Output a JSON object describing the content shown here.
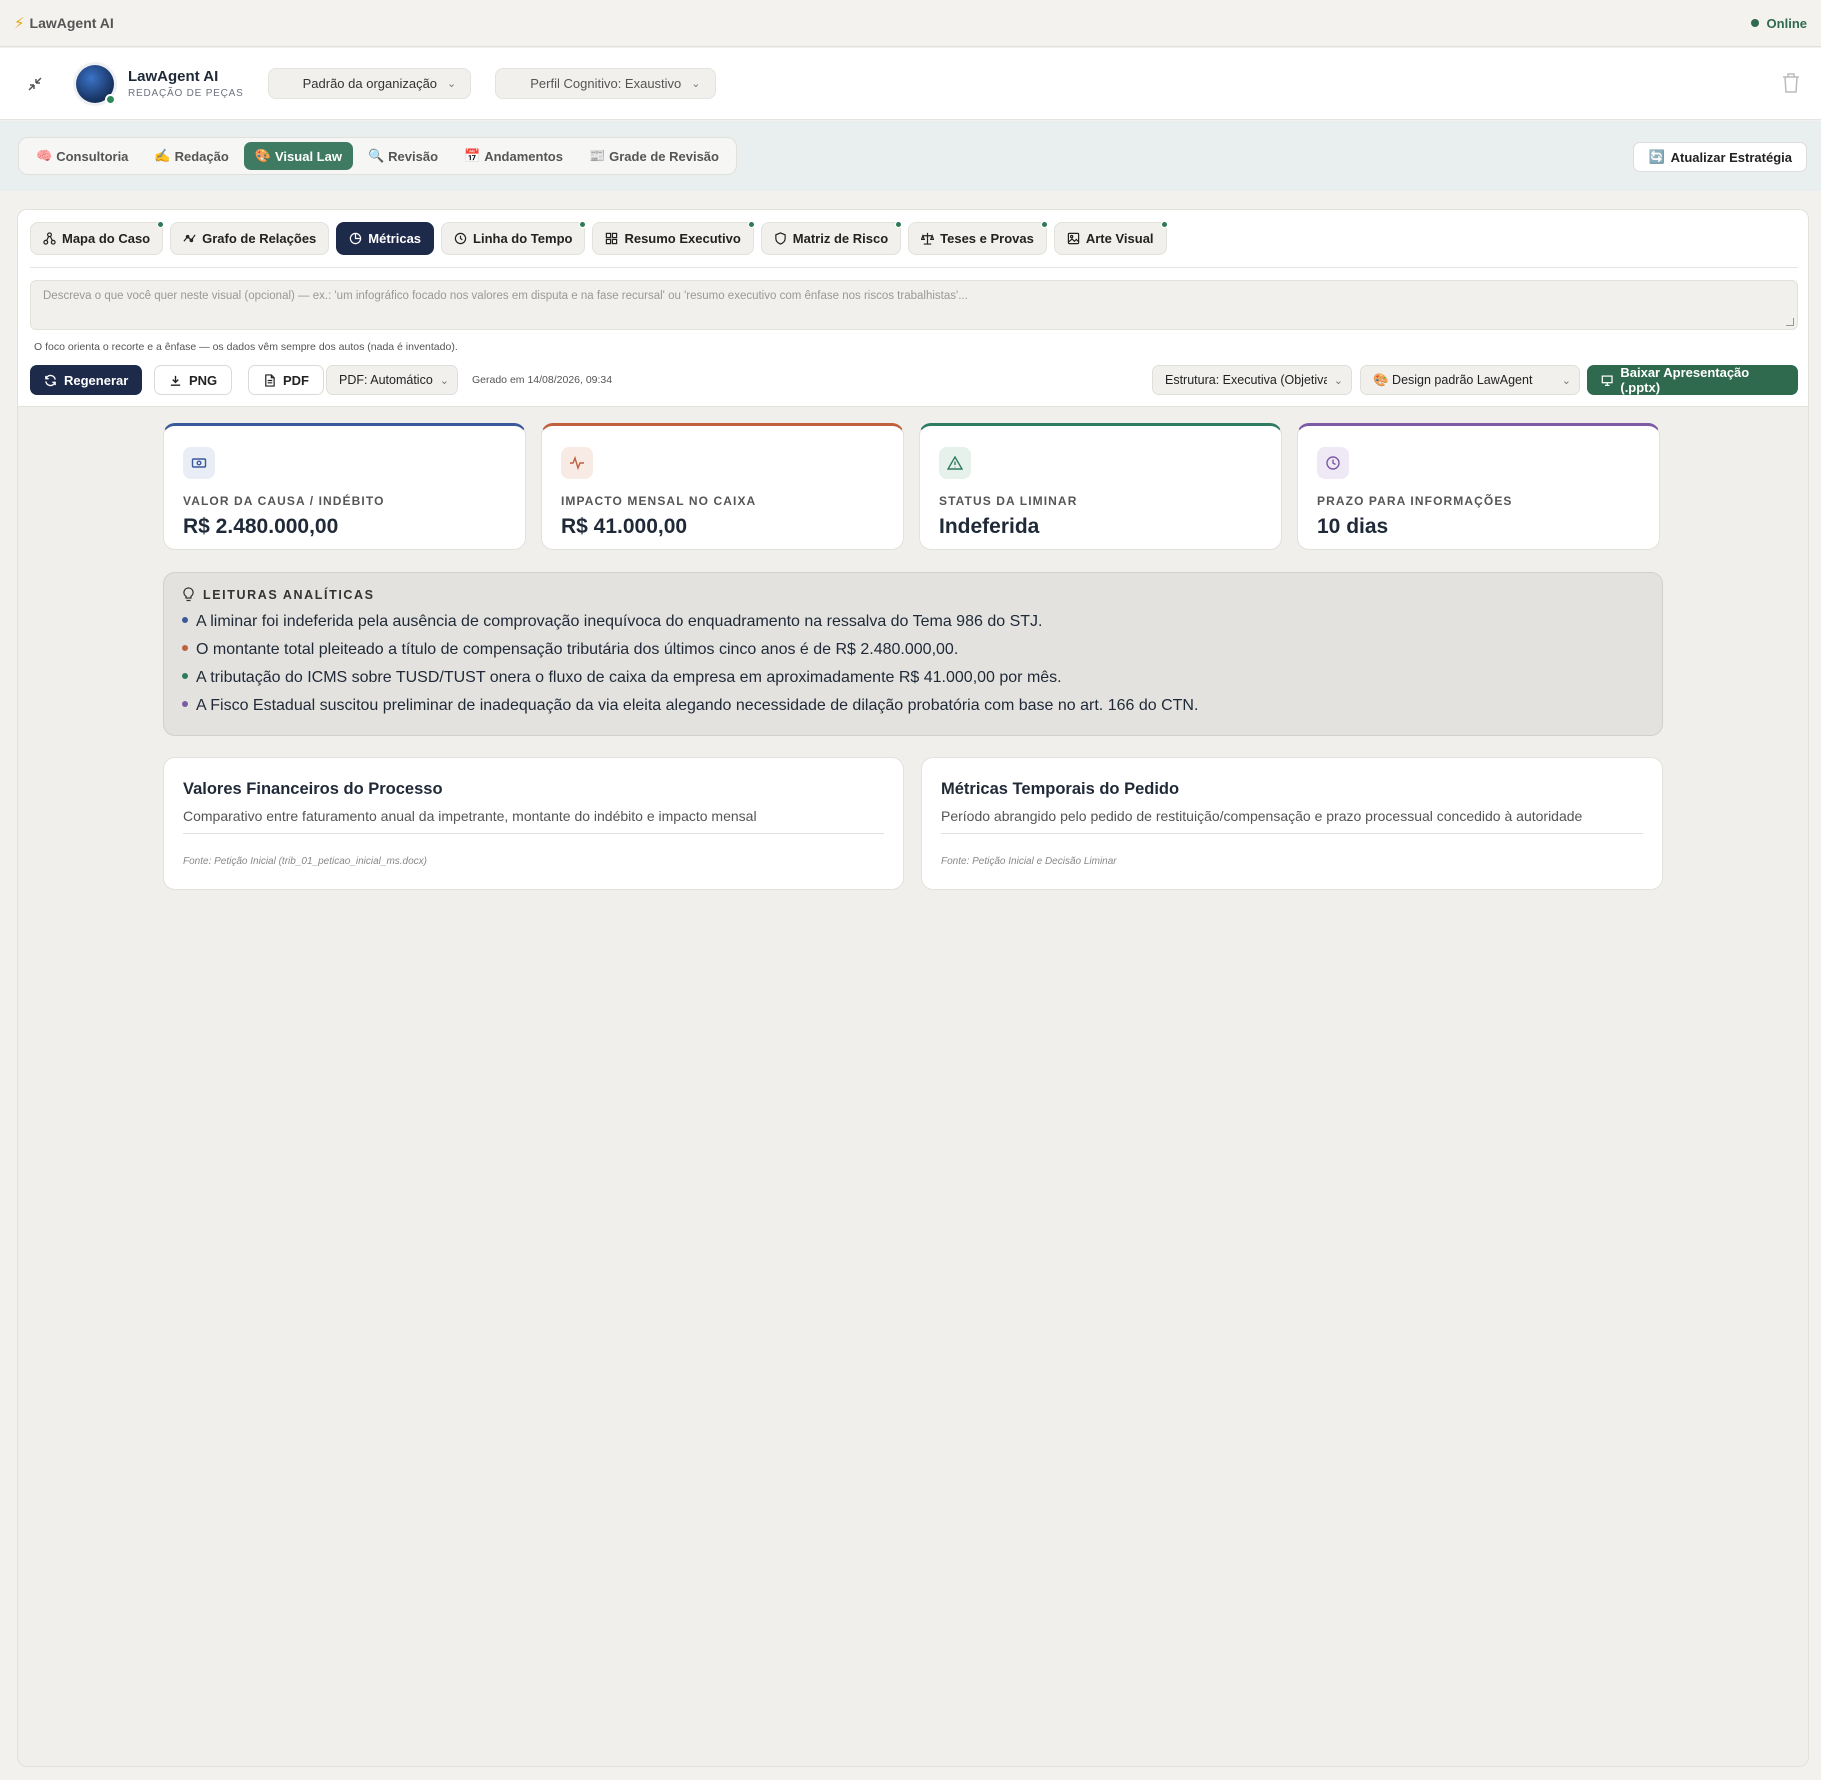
{
  "app": {
    "title": "LawAgent AI",
    "status": "Online"
  },
  "header": {
    "brand_name": "LawAgent AI",
    "brand_subtitle": "REDAÇÃO DE PEÇAS",
    "org_select": "Padrão da organização",
    "profile_select": "Perfil Cognitivo: Exaustivo"
  },
  "modes": [
    {
      "icon": "🧠",
      "label": "Consultoria"
    },
    {
      "icon": "✍️",
      "label": "Redação"
    },
    {
      "icon": "🎨",
      "label": "Visual Law"
    },
    {
      "icon": "🔍",
      "label": "Revisão"
    },
    {
      "icon": "📅",
      "label": "Andamentos"
    },
    {
      "icon": "📰",
      "label": "Grade de Revisão"
    }
  ],
  "update_button": "Atualizar Estratégia",
  "visual_tabs": [
    {
      "label": "Mapa do Caso",
      "icon": "nodes-icon"
    },
    {
      "label": "Grafo de Relações",
      "icon": "graph-icon"
    },
    {
      "label": "Métricas",
      "icon": "pie-icon"
    },
    {
      "label": "Linha do Tempo",
      "icon": "clock-icon"
    },
    {
      "label": "Resumo Executivo",
      "icon": "grid-icon"
    },
    {
      "label": "Matriz de Risco",
      "icon": "shield-icon"
    },
    {
      "label": "Teses e Provas",
      "icon": "scale-icon"
    },
    {
      "label": "Arte Visual",
      "icon": "image-icon"
    }
  ],
  "prompt_placeholder": "Descreva o que você quer neste visual (opcional) — ex.: 'um infográfico focado nos valores em disputa e na fase recursal' ou 'resumo executivo com ênfase nos riscos trabalhistas'...",
  "hint": "O foco orienta o recorte e a ênfase — os dados vêm sempre dos autos (nada é inventado).",
  "toolbar": {
    "regenerate": "Regenerar",
    "png": "PNG",
    "pdf": "PDF",
    "pdf_mode": "PDF: Automático",
    "generated": "Gerado em 14/08/2026, 09:34",
    "structure": "Estrutura: Executiva (Objetiva)",
    "design": "🎨 Design padrão LawAgent",
    "download": "Baixar Apresentação (.pptx)"
  },
  "kpis": [
    {
      "label": "VALOR DA CAUSA / INDÉBITO",
      "value": "R$ 2.480.000,00",
      "color": "#3b5a9a",
      "icon": "money-icon"
    },
    {
      "label": "IMPACTO MENSAL NO CAIXA",
      "value": "R$ 41.000,00",
      "color": "#c0603c",
      "icon": "pulse-icon"
    },
    {
      "label": "STATUS DA LIMINAR",
      "value": "Indeferida",
      "color": "#2f7a62",
      "icon": "warning-icon"
    },
    {
      "label": "PRAZO PARA INFORMAÇÕES",
      "value": "10 dias",
      "color": "#7c5aa6",
      "icon": "clock-icon"
    }
  ],
  "insights": {
    "title": "LEITURAS ANALÍTICAS",
    "items": [
      {
        "text": "A liminar foi indeferida pela ausência de comprovação inequívoca do enquadramento na ressalva do Tema 986 do STJ.",
        "color": "#3b5a9a"
      },
      {
        "text": "O montante total pleiteado a título de compensação tributária dos últimos cinco anos é de R$ 2.480.000,00.",
        "color": "#c0603c"
      },
      {
        "text": "A tributação do ICMS sobre TUSD/TUST onera o fluxo de caixa da empresa em aproximadamente R$ 41.000,00 por mês.",
        "color": "#2f7a62"
      },
      {
        "text": "A Fisco Estadual suscitou preliminar de inadequação da via eleita alegando necessidade de dilação probatória com base no art. 166 do CTN.",
        "color": "#7c5aa6"
      }
    ]
  },
  "charts": [
    {
      "title": "Valores Financeiros do Processo",
      "subtitle": "Comparativo entre faturamento anual da impetrante, montante do indébito e impacto mensal",
      "source": "Fonte: Petição Inicial (trib_01_peticao_inicial_ms.docx)"
    },
    {
      "title": "Métricas Temporais do Pedido",
      "subtitle": "Período abrangido pelo pedido de restituição/compensação e prazo processual concedido à autoridade",
      "source": "Fonte: Petição Inicial e Decisão Liminar"
    }
  ]
}
